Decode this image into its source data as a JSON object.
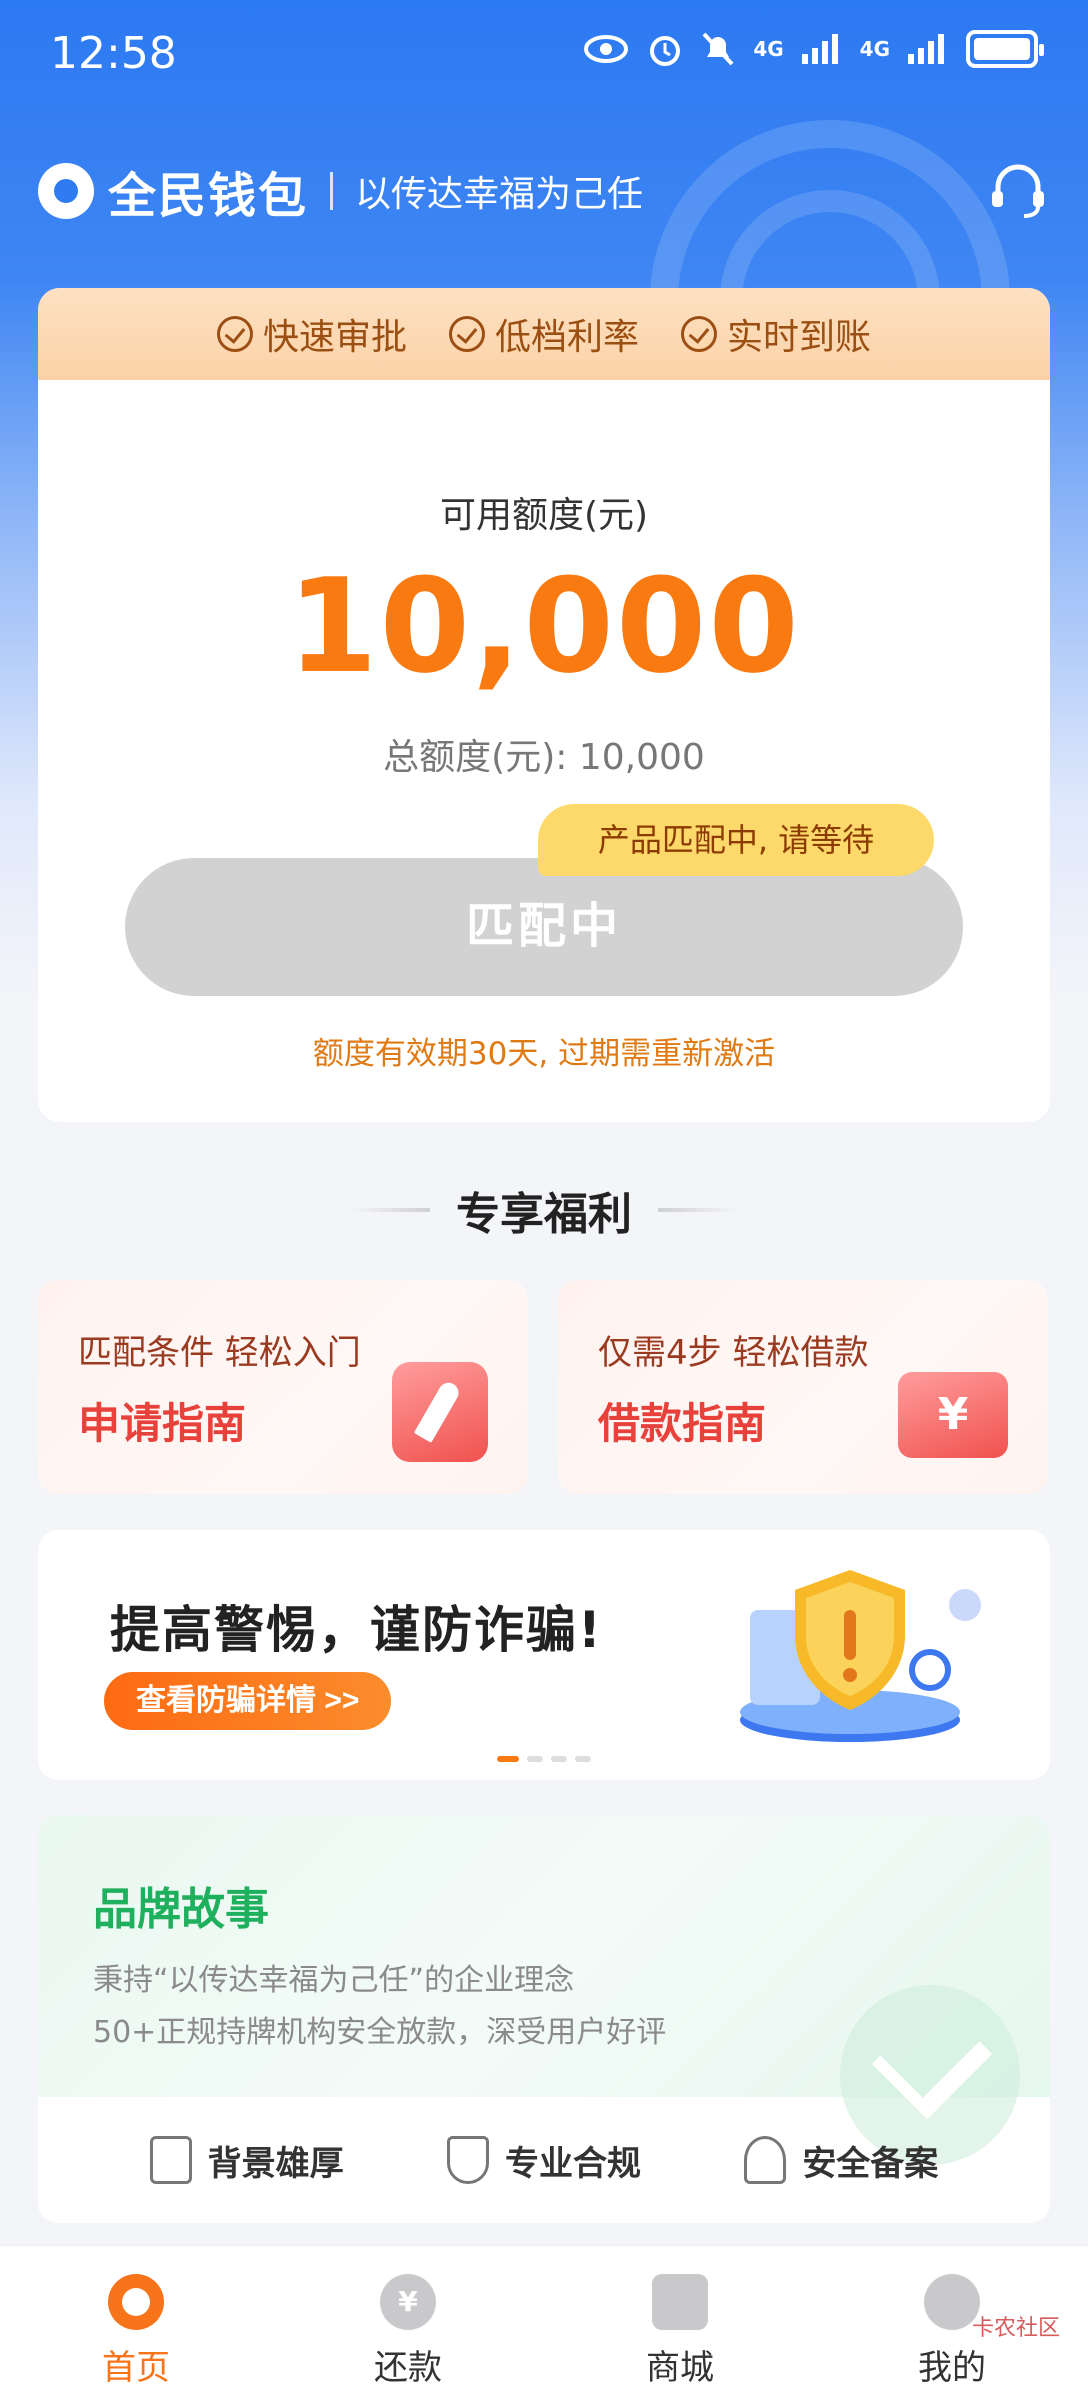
{
  "status_bar": {
    "time": "12:58",
    "signal1": "4G",
    "signal2": "4G"
  },
  "header": {
    "brand": "全民钱包",
    "slogan": "以传达幸福为己任"
  },
  "card": {
    "features": [
      "快速审批",
      "低档利率",
      "实时到账"
    ],
    "available_label": "可用额度(元)",
    "available_amount": "10,000",
    "total_line": "总额度(元): 10,000",
    "tooltip": "产品匹配中, 请等待",
    "button_label": "匹配中",
    "validity": "额度有效期30天, 过期需重新激活"
  },
  "benefits": {
    "title": "专享福利",
    "cards": [
      {
        "sub": "匹配条件 轻松入门",
        "main": "申请指南",
        "icon": "compass-icon"
      },
      {
        "sub": "仅需4步 轻松借款",
        "main": "借款指南",
        "icon": "yuan-ticket-icon"
      }
    ]
  },
  "fraud": {
    "title": "提高警惕，谨防诈骗!",
    "button": "查看防骗详情 >>",
    "slide_count": 4,
    "active_slide": 0
  },
  "brand_story": {
    "title": "品牌故事",
    "desc1": "秉持“以传达幸福为己任”的企业理念",
    "desc2": "50+正规持牌机构安全放款，深受用户好评",
    "features": [
      "背景雄厚",
      "专业合规",
      "安全备案"
    ]
  },
  "nav": {
    "items": [
      "首页",
      "还款",
      "商城",
      "我的"
    ],
    "active": "首页"
  },
  "watermark": "卡农社区",
  "colors": {
    "primary_blue": "#2c79f2",
    "accent_orange": "#fa7a12",
    "green": "#1fb05d",
    "red": "#e8403a"
  }
}
